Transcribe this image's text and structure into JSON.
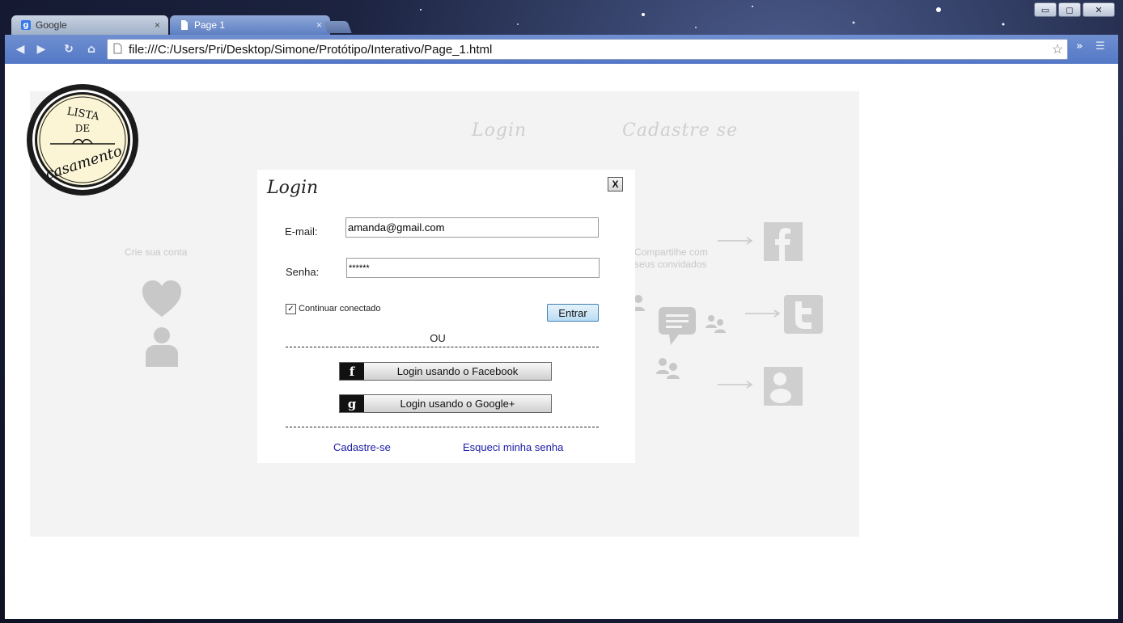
{
  "browser": {
    "tabs": [
      {
        "label": "Google",
        "favicon": "g",
        "close": "×"
      },
      {
        "label": "Page 1",
        "favicon": "page-icon",
        "close": "×"
      }
    ],
    "url": "file:///C:/Users/Pri/Desktop/Simone/Protótipo/Interativo/Page_1.html",
    "window_buttons": {
      "minimize": "▭",
      "maximize": "◻",
      "close": "✕"
    }
  },
  "page": {
    "logo": {
      "line1": "LISTA",
      "line2": "DE",
      "line3": "casamento"
    },
    "nav": {
      "login": "Login",
      "signup": "Cadastre se"
    },
    "left_panel": {
      "title": "Crie sua conta"
    },
    "right_panel": {
      "title_line1": "Compartilhe com",
      "title_line2": "seus convidados"
    }
  },
  "modal": {
    "title": "Login",
    "close_label": "X",
    "email_label": "E-mail:",
    "email_value": "amanda@gmail.com",
    "password_label": "Senha:",
    "password_value": "******",
    "remember_label": "Continuar conectado",
    "remember_checked": true,
    "submit_label": "Entrar",
    "or_label": "OU",
    "facebook_label": "Login usando o Facebook",
    "google_label": "Login usando o Google+",
    "signup_link": "Cadastre-se",
    "forgot_link": "Esqueci minha senha"
  },
  "colors": {
    "canvas_bg": "#f3f3f3",
    "link": "#1a1aa6",
    "toolbar": "#5478c6",
    "icon_grey": "#c8c8c8"
  }
}
